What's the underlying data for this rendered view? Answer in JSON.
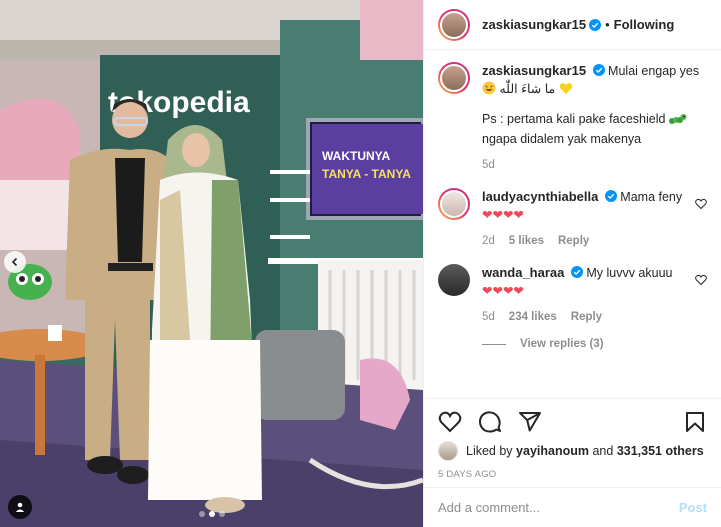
{
  "post": {
    "brand_sign": "tokopedia",
    "screen_text": "WAKTUNYA TANYA - TANYA",
    "image_icons": [
      "chevron-left-icon",
      "user-tag-icon"
    ],
    "carousel_index": 2,
    "carousel_count": 3
  },
  "header": {
    "username": "zaskiasungkar15",
    "separator": "•",
    "follow_label": "Following"
  },
  "caption": {
    "username": "zaskiasungkar15",
    "text": "Mulai engap yes",
    "arabic": "ما شاءَ اللّٰه",
    "ps": "Ps : pertama kali pake faceshield",
    "ps2": "ngapa didalem yak makenya",
    "time": "5d"
  },
  "comments": [
    {
      "username": "laudyacynthiabella",
      "text": "Mama feny",
      "hearts": "❤❤❤❤",
      "time": "2d",
      "likes": "5 likes",
      "reply": "Reply"
    },
    {
      "username": "wanda_haraa",
      "text": "My luvvv akuuu",
      "hearts": "❤❤❤❤",
      "time": "5d",
      "likes": "234 likes",
      "reply": "Reply",
      "view_replies": "View replies (3)"
    }
  ],
  "likes": {
    "prefix": "Liked by",
    "user": "yayihanoum",
    "and": "and",
    "count": "331,351 others"
  },
  "posted_ago": "5 DAYS AGO",
  "add_comment": {
    "placeholder": "Add a comment...",
    "post_label": "Post"
  },
  "colors": {
    "verified": "#0095f6",
    "heart": "#ed4956",
    "post_disabled": "#b2dffc",
    "studio_green": "#3d6a60"
  }
}
